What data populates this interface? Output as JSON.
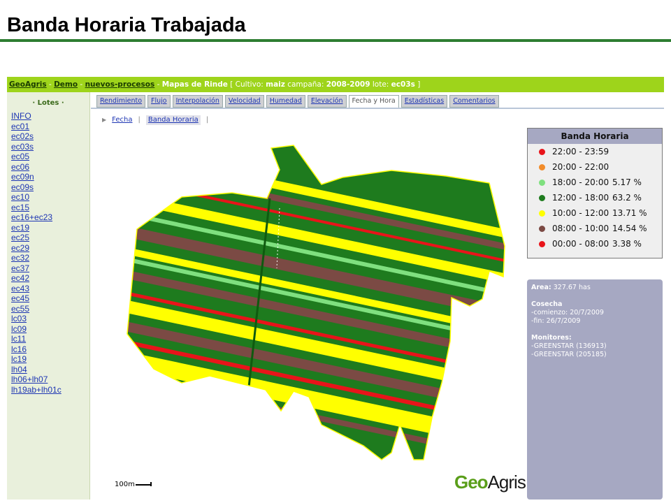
{
  "slide": {
    "title": "Banda Horaria Trabajada"
  },
  "topbar": {
    "geoagris": "GeoAgris",
    "sep1": " - ",
    "demo": "Demo",
    "sep2": " - ",
    "procesos": "nuevos-procesos",
    "sep3": " - ",
    "mapas": "Mapas de Rinde",
    "details_pre": " [ Cultivo: ",
    "cultivo": "maiz",
    "campana_lbl": " campaña: ",
    "campana": "2008-2009",
    "lote_lbl": " lote: ",
    "lote": "ec03s",
    "details_post": " ]"
  },
  "sidebar": {
    "header": "· Lotes ·",
    "items": [
      "INFO",
      "ec01",
      "ec02s",
      "ec03s",
      "ec05",
      "ec06",
      "ec09n",
      "ec09s",
      "ec10",
      "ec15",
      "ec16+ec23",
      "ec19",
      "ec25",
      "ec29",
      "ec32",
      "ec37",
      "ec42",
      "ec43",
      "ec45",
      "ec55",
      "lc03",
      "lc09",
      "lc11",
      "lc16",
      "lc19",
      "lh04",
      "lh06+lh07",
      "lh19ab+lh01c"
    ]
  },
  "tabs": [
    "Rendimiento",
    "Flujo",
    "Interpolación",
    "Velocidad",
    "Humedad",
    "Elevación",
    "Fecha y Hora",
    "Estadísticas",
    "Comentarios"
  ],
  "active_tab": "Fecha y Hora",
  "subtabs": {
    "fecha": "Fecha",
    "banda": "Banda Horaria",
    "sep": "|"
  },
  "legend": {
    "title": "Banda Horaria",
    "rows": [
      {
        "range": "22:00 - 23:59",
        "pct": "",
        "color": "#e8141a"
      },
      {
        "range": "20:00 - 22:00",
        "pct": "",
        "color": "#f28c2a"
      },
      {
        "range": "18:00 - 20:00",
        "pct": "5.17 %",
        "color": "#7fe07f"
      },
      {
        "range": "12:00 - 18:00",
        "pct": "63.2 %",
        "color": "#1e7b1e"
      },
      {
        "range": "10:00 - 12:00",
        "pct": "13.71 %",
        "color": "#ffff00"
      },
      {
        "range": "08:00 - 10:00",
        "pct": "14.54 %",
        "color": "#7b4a44"
      },
      {
        "range": "00:00 - 08:00",
        "pct": "3.38 %",
        "color": "#e8141a"
      }
    ]
  },
  "info": {
    "area_label": "Area:",
    "area_value": "327.67 has",
    "cosecha_label": "Cosecha",
    "comienzo": "-comienzo: 20/7/2009",
    "fin": "-fin: 26/7/2009",
    "monitores_label": "Monitores:",
    "monitor1": "-GREENSTAR (136913)",
    "monitor2": "-GREENSTAR (205185)"
  },
  "scale": {
    "label": "100m"
  },
  "brand": {
    "geo": "Geo",
    "agris": "Agris"
  },
  "colors": {
    "green": "#1e7b1e",
    "yellow": "#ffff00",
    "brown": "#7b4a44",
    "red": "#e8141a",
    "light_green": "#7fe07f",
    "topbar": "#9ed41b",
    "title_rule": "#2e7d32"
  }
}
